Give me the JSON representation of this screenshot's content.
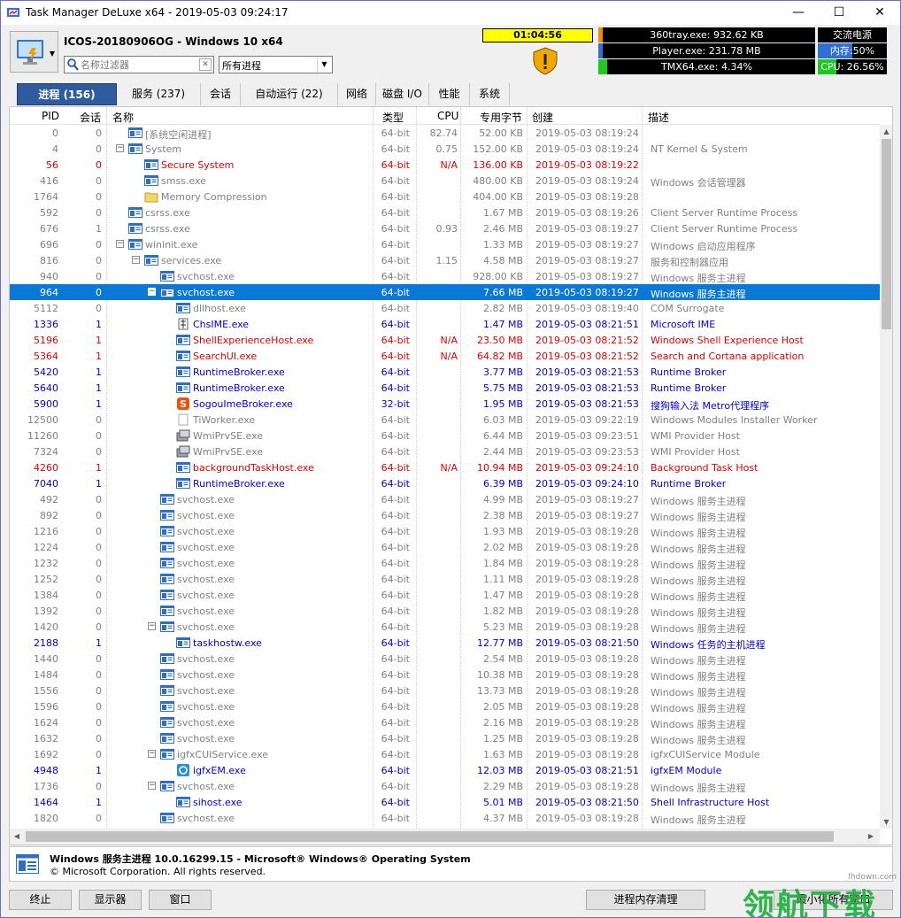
{
  "window": {
    "title": "Task Manager DeLuxe x64 - 2019-05-03 09:24:17",
    "min": "—",
    "max": "☐",
    "close": "✕"
  },
  "header": {
    "hostline": "ICOS-20180906OG - Windows 10 x64",
    "filter_placeholder": "名称过滤器",
    "process_select": "所有进程",
    "timer": "01:04:56"
  },
  "monitors": {
    "top1": {
      "text": "360tray.exe: 932.62 KB",
      "fill": 0.02
    },
    "top2": {
      "text": "Player.exe: 231.78 MB",
      "fill": 0.02
    },
    "top3": {
      "text": "TMX64.exe: 4.34%",
      "fill": 0.04
    },
    "power": {
      "text": "交流电源"
    },
    "memory": {
      "text": "内存:50%",
      "fill": 0.5
    },
    "cpu": {
      "text": "CPU: 26.56%",
      "fill": 0.27
    }
  },
  "tabs": [
    {
      "label": "进程 (156)"
    },
    {
      "label": "服务 (237)"
    },
    {
      "label": "会话"
    },
    {
      "label": "自动运行 (22)"
    },
    {
      "label": "网络"
    },
    {
      "label": "磁盘 I/O"
    },
    {
      "label": "性能"
    },
    {
      "label": "系统"
    }
  ],
  "columns": {
    "pid": "PID",
    "session": "会话",
    "name": "名称",
    "type": "类型",
    "cpu": "CPU",
    "mem": "专用字节",
    "created": "创建",
    "desc": "描述"
  },
  "colors": {
    "gray": "#808080",
    "red": "#e00000",
    "blue": "#0000e0",
    "selected": "#0a78d7",
    "accent": "#2d5b9e"
  },
  "processes": [
    {
      "pid": "0",
      "ses": "0",
      "name": "[系统空闲进程]",
      "type": "64-bit",
      "cpu": "82.74",
      "mem": "52.00 KB",
      "created": "2019-05-03 08:19:24",
      "desc": "",
      "color": "gray",
      "indent": 1,
      "toggle": "",
      "icon": "win"
    },
    {
      "pid": "4",
      "ses": "0",
      "name": "System",
      "type": "64-bit",
      "cpu": "0.75",
      "mem": "152.00 KB",
      "created": "2019-05-03 08:19:24",
      "desc": "NT Kernel & System",
      "color": "gray",
      "indent": 1,
      "toggle": "−",
      "icon": "win"
    },
    {
      "pid": "56",
      "ses": "0",
      "name": "Secure System",
      "type": "64-bit",
      "cpu": "N/A",
      "mem": "136.00 KB",
      "created": "2019-05-03 08:19:22",
      "desc": "",
      "color": "red",
      "indent": 2,
      "toggle": "",
      "icon": "win"
    },
    {
      "pid": "416",
      "ses": "0",
      "name": "smss.exe",
      "type": "64-bit",
      "cpu": "",
      "mem": "480.00 KB",
      "created": "2019-05-03 08:19:24",
      "desc": "Windows 会话管理器",
      "color": "gray",
      "indent": 2,
      "toggle": "",
      "icon": "win"
    },
    {
      "pid": "1764",
      "ses": "0",
      "name": "Memory Compression",
      "type": "64-bit",
      "cpu": "",
      "mem": "404.00 KB",
      "created": "2019-05-03 08:19:28",
      "desc": "",
      "color": "gray",
      "indent": 2,
      "toggle": "",
      "icon": "folder"
    },
    {
      "pid": "592",
      "ses": "0",
      "name": "csrss.exe",
      "type": "64-bit",
      "cpu": "",
      "mem": "1.67 MB",
      "created": "2019-05-03 08:19:26",
      "desc": "Client Server Runtime Process",
      "color": "gray",
      "indent": 1,
      "toggle": "",
      "icon": "win"
    },
    {
      "pid": "676",
      "ses": "1",
      "name": "csrss.exe",
      "type": "64-bit",
      "cpu": "0.93",
      "mem": "2.46 MB",
      "created": "2019-05-03 08:19:27",
      "desc": "Client Server Runtime Process",
      "color": "gray",
      "indent": 1,
      "toggle": "",
      "icon": "win"
    },
    {
      "pid": "696",
      "ses": "0",
      "name": "wininit.exe",
      "type": "64-bit",
      "cpu": "",
      "mem": "1.33 MB",
      "created": "2019-05-03 08:19:27",
      "desc": "Windows 启动应用程序",
      "color": "gray",
      "indent": 1,
      "toggle": "−",
      "icon": "win"
    },
    {
      "pid": "816",
      "ses": "0",
      "name": "services.exe",
      "type": "64-bit",
      "cpu": "1.15",
      "mem": "4.58 MB",
      "created": "2019-05-03 08:19:27",
      "desc": "服务和控制器应用",
      "color": "gray",
      "indent": 2,
      "toggle": "−",
      "icon": "win"
    },
    {
      "pid": "940",
      "ses": "0",
      "name": "svchost.exe",
      "type": "64-bit",
      "cpu": "",
      "mem": "928.00 KB",
      "created": "2019-05-03 08:19:27",
      "desc": "Windows 服务主进程",
      "color": "gray",
      "indent": 3,
      "toggle": "",
      "icon": "win"
    },
    {
      "pid": "964",
      "ses": "0",
      "name": "svchost.exe",
      "type": "64-bit",
      "cpu": "",
      "mem": "7.66 MB",
      "created": "2019-05-03 08:19:27",
      "desc": "Windows 服务主进程",
      "color": "sel",
      "indent": 3,
      "toggle": "−",
      "icon": "win",
      "selected": true
    },
    {
      "pid": "5112",
      "ses": "0",
      "name": "dllhost.exe",
      "type": "64-bit",
      "cpu": "",
      "mem": "2.82 MB",
      "created": "2019-05-03 08:19:40",
      "desc": "COM Surrogate",
      "color": "gray",
      "indent": 4,
      "toggle": "",
      "icon": "win"
    },
    {
      "pid": "1336",
      "ses": "1",
      "name": "ChsIME.exe",
      "type": "64-bit",
      "cpu": "",
      "mem": "1.47 MB",
      "created": "2019-05-03 08:21:51",
      "desc": "Microsoft IME",
      "color": "blue",
      "indent": 4,
      "toggle": "",
      "icon": "ime"
    },
    {
      "pid": "5196",
      "ses": "1",
      "name": "ShellExperienceHost.exe",
      "type": "64-bit",
      "cpu": "N/A",
      "mem": "23.50 MB",
      "created": "2019-05-03 08:21:52",
      "desc": "Windows Shell Experience Host",
      "color": "red",
      "indent": 4,
      "toggle": "",
      "icon": "win"
    },
    {
      "pid": "5364",
      "ses": "1",
      "name": "SearchUI.exe",
      "type": "64-bit",
      "cpu": "N/A",
      "mem": "64.82 MB",
      "created": "2019-05-03 08:21:52",
      "desc": "Search and Cortana application",
      "color": "red",
      "indent": 4,
      "toggle": "",
      "icon": "win"
    },
    {
      "pid": "5420",
      "ses": "1",
      "name": "RuntimeBroker.exe",
      "type": "64-bit",
      "cpu": "",
      "mem": "3.77 MB",
      "created": "2019-05-03 08:21:53",
      "desc": "Runtime Broker",
      "color": "blue",
      "indent": 4,
      "toggle": "",
      "icon": "win"
    },
    {
      "pid": "5640",
      "ses": "1",
      "name": "RuntimeBroker.exe",
      "type": "64-bit",
      "cpu": "",
      "mem": "5.75 MB",
      "created": "2019-05-03 08:21:53",
      "desc": "Runtime Broker",
      "color": "blue",
      "indent": 4,
      "toggle": "",
      "icon": "win"
    },
    {
      "pid": "5900",
      "ses": "1",
      "name": "SogouImeBroker.exe",
      "type": "32-bit",
      "cpu": "",
      "mem": "1.95 MB",
      "created": "2019-05-03 08:21:53",
      "desc": "搜狗输入法 Metro代理程序",
      "color": "blue",
      "indent": 4,
      "toggle": "",
      "icon": "sogou"
    },
    {
      "pid": "12500",
      "ses": "0",
      "name": "TiWorker.exe",
      "type": "64-bit",
      "cpu": "",
      "mem": "6.03 MB",
      "created": "2019-05-03 09:22:19",
      "desc": "Windows Modules Installer Worker",
      "color": "gray",
      "indent": 4,
      "toggle": "",
      "icon": "blank"
    },
    {
      "pid": "11260",
      "ses": "0",
      "name": "WmiPrvSE.exe",
      "type": "64-bit",
      "cpu": "",
      "mem": "6.44 MB",
      "created": "2019-05-03 09:23:51",
      "desc": "WMI Provider Host",
      "color": "gray",
      "indent": 4,
      "toggle": "",
      "icon": "wmi"
    },
    {
      "pid": "7324",
      "ses": "0",
      "name": "WmiPrvSE.exe",
      "type": "64-bit",
      "cpu": "",
      "mem": "2.44 MB",
      "created": "2019-05-03 09:23:53",
      "desc": "WMI Provider Host",
      "color": "gray",
      "indent": 4,
      "toggle": "",
      "icon": "wmi"
    },
    {
      "pid": "4260",
      "ses": "1",
      "name": "backgroundTaskHost.exe",
      "type": "64-bit",
      "cpu": "N/A",
      "mem": "10.94 MB",
      "created": "2019-05-03 09:24:10",
      "desc": "Background Task Host",
      "color": "red",
      "indent": 4,
      "toggle": "",
      "icon": "win"
    },
    {
      "pid": "7040",
      "ses": "1",
      "name": "RuntimeBroker.exe",
      "type": "64-bit",
      "cpu": "",
      "mem": "6.39 MB",
      "created": "2019-05-03 09:24:10",
      "desc": "Runtime Broker",
      "color": "blue",
      "indent": 4,
      "toggle": "",
      "icon": "win"
    },
    {
      "pid": "492",
      "ses": "0",
      "name": "svchost.exe",
      "type": "64-bit",
      "cpu": "",
      "mem": "4.99 MB",
      "created": "2019-05-03 08:19:27",
      "desc": "Windows 服务主进程",
      "color": "gray",
      "indent": 3,
      "toggle": "",
      "icon": "win"
    },
    {
      "pid": "892",
      "ses": "0",
      "name": "svchost.exe",
      "type": "64-bit",
      "cpu": "",
      "mem": "2.38 MB",
      "created": "2019-05-03 08:19:27",
      "desc": "Windows 服务主进程",
      "color": "gray",
      "indent": 3,
      "toggle": "",
      "icon": "win"
    },
    {
      "pid": "1216",
      "ses": "0",
      "name": "svchost.exe",
      "type": "64-bit",
      "cpu": "",
      "mem": "1.93 MB",
      "created": "2019-05-03 08:19:28",
      "desc": "Windows 服务主进程",
      "color": "gray",
      "indent": 3,
      "toggle": "",
      "icon": "win"
    },
    {
      "pid": "1224",
      "ses": "0",
      "name": "svchost.exe",
      "type": "64-bit",
      "cpu": "",
      "mem": "2.02 MB",
      "created": "2019-05-03 08:19:28",
      "desc": "Windows 服务主进程",
      "color": "gray",
      "indent": 3,
      "toggle": "",
      "icon": "win"
    },
    {
      "pid": "1232",
      "ses": "0",
      "name": "svchost.exe",
      "type": "64-bit",
      "cpu": "",
      "mem": "1.84 MB",
      "created": "2019-05-03 08:19:28",
      "desc": "Windows 服务主进程",
      "color": "gray",
      "indent": 3,
      "toggle": "",
      "icon": "win"
    },
    {
      "pid": "1252",
      "ses": "0",
      "name": "svchost.exe",
      "type": "64-bit",
      "cpu": "",
      "mem": "1.11 MB",
      "created": "2019-05-03 08:19:28",
      "desc": "Windows 服务主进程",
      "color": "gray",
      "indent": 3,
      "toggle": "",
      "icon": "win"
    },
    {
      "pid": "1384",
      "ses": "0",
      "name": "svchost.exe",
      "type": "64-bit",
      "cpu": "",
      "mem": "1.47 MB",
      "created": "2019-05-03 08:19:28",
      "desc": "Windows 服务主进程",
      "color": "gray",
      "indent": 3,
      "toggle": "",
      "icon": "win"
    },
    {
      "pid": "1392",
      "ses": "0",
      "name": "svchost.exe",
      "type": "64-bit",
      "cpu": "",
      "mem": "1.82 MB",
      "created": "2019-05-03 08:19:28",
      "desc": "Windows 服务主进程",
      "color": "gray",
      "indent": 3,
      "toggle": "",
      "icon": "win"
    },
    {
      "pid": "1420",
      "ses": "0",
      "name": "svchost.exe",
      "type": "64-bit",
      "cpu": "",
      "mem": "5.23 MB",
      "created": "2019-05-03 08:19:28",
      "desc": "Windows 服务主进程",
      "color": "gray",
      "indent": 3,
      "toggle": "−",
      "icon": "win"
    },
    {
      "pid": "2188",
      "ses": "1",
      "name": "taskhostw.exe",
      "type": "64-bit",
      "cpu": "",
      "mem": "12.77 MB",
      "created": "2019-05-03 08:21:50",
      "desc": "Windows 任务的主机进程",
      "color": "blue",
      "indent": 4,
      "toggle": "",
      "icon": "win"
    },
    {
      "pid": "1440",
      "ses": "0",
      "name": "svchost.exe",
      "type": "64-bit",
      "cpu": "",
      "mem": "2.54 MB",
      "created": "2019-05-03 08:19:28",
      "desc": "Windows 服务主进程",
      "color": "gray",
      "indent": 3,
      "toggle": "",
      "icon": "win"
    },
    {
      "pid": "1484",
      "ses": "0",
      "name": "svchost.exe",
      "type": "64-bit",
      "cpu": "",
      "mem": "10.38 MB",
      "created": "2019-05-03 08:19:28",
      "desc": "Windows 服务主进程",
      "color": "gray",
      "indent": 3,
      "toggle": "",
      "icon": "win"
    },
    {
      "pid": "1556",
      "ses": "0",
      "name": "svchost.exe",
      "type": "64-bit",
      "cpu": "",
      "mem": "13.73 MB",
      "created": "2019-05-03 08:19:28",
      "desc": "Windows 服务主进程",
      "color": "gray",
      "indent": 3,
      "toggle": "",
      "icon": "win"
    },
    {
      "pid": "1596",
      "ses": "0",
      "name": "svchost.exe",
      "type": "64-bit",
      "cpu": "",
      "mem": "2.05 MB",
      "created": "2019-05-03 08:19:28",
      "desc": "Windows 服务主进程",
      "color": "gray",
      "indent": 3,
      "toggle": "",
      "icon": "win"
    },
    {
      "pid": "1624",
      "ses": "0",
      "name": "svchost.exe",
      "type": "64-bit",
      "cpu": "",
      "mem": "2.16 MB",
      "created": "2019-05-03 08:19:28",
      "desc": "Windows 服务主进程",
      "color": "gray",
      "indent": 3,
      "toggle": "",
      "icon": "win"
    },
    {
      "pid": "1632",
      "ses": "0",
      "name": "svchost.exe",
      "type": "64-bit",
      "cpu": "",
      "mem": "1.25 MB",
      "created": "2019-05-03 08:19:28",
      "desc": "Windows 服务主进程",
      "color": "gray",
      "indent": 3,
      "toggle": "",
      "icon": "win"
    },
    {
      "pid": "1692",
      "ses": "0",
      "name": "igfxCUIService.exe",
      "type": "64-bit",
      "cpu": "",
      "mem": "1.63 MB",
      "created": "2019-05-03 08:19:28",
      "desc": "igfxCUIService Module",
      "color": "gray",
      "indent": 3,
      "toggle": "−",
      "icon": "win"
    },
    {
      "pid": "4948",
      "ses": "1",
      "name": "igfxEM.exe",
      "type": "64-bit",
      "cpu": "",
      "mem": "12.03 MB",
      "created": "2019-05-03 08:21:51",
      "desc": "igfxEM Module",
      "color": "blue",
      "indent": 4,
      "toggle": "",
      "icon": "intel"
    },
    {
      "pid": "1736",
      "ses": "0",
      "name": "svchost.exe",
      "type": "64-bit",
      "cpu": "",
      "mem": "2.29 MB",
      "created": "2019-05-03 08:19:28",
      "desc": "Windows 服务主进程",
      "color": "gray",
      "indent": 3,
      "toggle": "−",
      "icon": "win"
    },
    {
      "pid": "1464",
      "ses": "1",
      "name": "sihost.exe",
      "type": "64-bit",
      "cpu": "",
      "mem": "5.01 MB",
      "created": "2019-05-03 08:21:50",
      "desc": "Shell Infrastructure Host",
      "color": "blue",
      "indent": 4,
      "toggle": "",
      "icon": "win"
    },
    {
      "pid": "1820",
      "ses": "0",
      "name": "svchost.exe",
      "type": "64-bit",
      "cpu": "",
      "mem": "4.37 MB",
      "created": "2019-05-03 08:19:28",
      "desc": "Windows 服务主进程",
      "color": "gray",
      "indent": 3,
      "toggle": "",
      "icon": "win"
    }
  ],
  "info": {
    "line1": "Windows 服务主进程 10.0.16299.15 - Microsoft® Windows® Operating System",
    "line2": "© Microsoft Corporation. All rights reserved."
  },
  "buttons": {
    "terminate": "终止",
    "monitor": "显示器",
    "window": "窗口",
    "mem_clean": "进程内存清理",
    "min_all": "最小化所有窗口"
  },
  "watermark": {
    "url": "lhdown.com",
    "text": "领航下载"
  }
}
